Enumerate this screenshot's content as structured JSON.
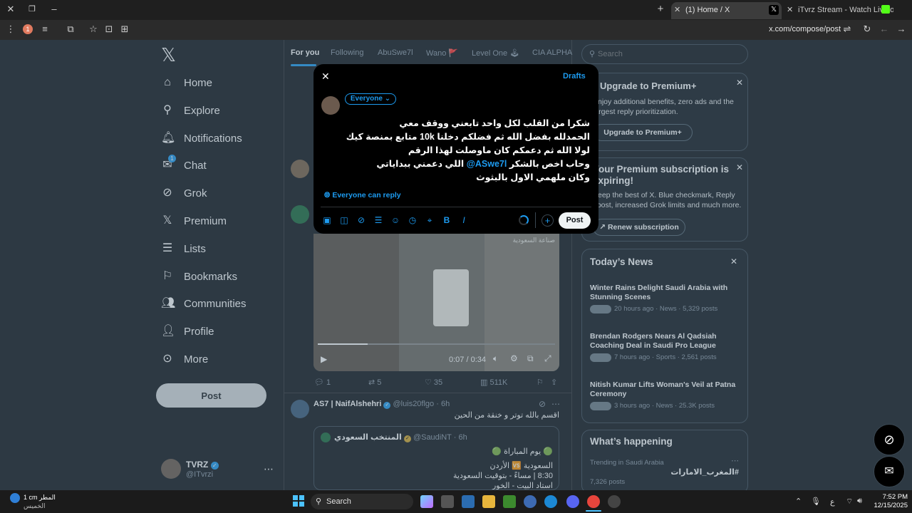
{
  "browser": {
    "tabs": [
      {
        "title": "(1) Home / X",
        "active": true
      },
      {
        "title": "iTvrz Stream - Watch Live on Ki",
        "active": false
      }
    ],
    "url": "x.com/compose/post",
    "profile_badge": "1"
  },
  "feed_tabs": [
    "For you",
    "Following",
    "AbuSwe7l",
    "Wano 🚩",
    "Level One 🕹",
    "CIA ALPHA"
  ],
  "search": {
    "placeholder": "Search"
  },
  "sidebar": {
    "items": [
      {
        "label": "Home",
        "icon": "home-icon"
      },
      {
        "label": "Explore",
        "icon": "search-icon"
      },
      {
        "label": "Notifications",
        "icon": "bell-icon"
      },
      {
        "label": "Chat",
        "icon": "mail-icon",
        "badge": "1"
      },
      {
        "label": "Grok",
        "icon": "grok-icon"
      },
      {
        "label": "Premium",
        "icon": "x-icon"
      },
      {
        "label": "Lists",
        "icon": "list-icon"
      },
      {
        "label": "Bookmarks",
        "icon": "bookmark-icon"
      },
      {
        "label": "Communities",
        "icon": "people-icon"
      },
      {
        "label": "Profile",
        "icon": "person-icon"
      },
      {
        "label": "More",
        "icon": "more-icon"
      }
    ],
    "post_button": "Post",
    "account": {
      "name": "TVRZ",
      "handle": "@ITvrzi"
    }
  },
  "compose": {
    "drafts": "Drafts",
    "audience": "Everyone",
    "text_lines": [
      "شكرا من القلب لكل واحد تابعني ووقف معي",
      "الحمدلله بفضل الله ثم فضلكم دخلنا 10k متابع بمنصة كيك",
      "لولا الله ثم دعمكم كان ماوصلت لهذا الرقم",
      "وحاب اخص بالشكر",
      "وكان ملهمي الاول بالبثوث"
    ],
    "mention": "@ASwe7l",
    "mention_suffix": "اللي دعمني ببداياتي",
    "reply_setting": "Everyone can reply",
    "post_button": "Post"
  },
  "video": {
    "time": "0:07 / 0:34",
    "watermark": "صناعة السعودية"
  },
  "post_actions": {
    "replies": "1",
    "reposts": "5",
    "likes": "35",
    "views": "511K"
  },
  "tweet": {
    "name": "AS7 | NaifAlshehri",
    "handle": "@luis20flgo",
    "time": "6h",
    "text": "اقسم بالله توتر و خنقة من الحين",
    "quote": {
      "name": "المنتخب السعودي",
      "handle": "@SaudiNT",
      "time": "6h",
      "lines": [
        "🟢 يوم المباراة 🟢",
        "السعودية 🆚 الأردن",
        "8:30 | مساءً - بتوقيت السعودية",
        "استاد البيت - الخور"
      ]
    }
  },
  "right": {
    "premium_plus": {
      "title": "Upgrade to Premium+",
      "body": "Enjoy additional benefits, zero ads and the largest reply prioritization.",
      "button": "Upgrade to Premium+"
    },
    "expiring": {
      "title": "Your Premium subscription is expiring!",
      "body": "Keep the best of X. Blue checkmark, Reply boost, increased Grok limits and much more.",
      "button": "Renew subscription"
    },
    "news": {
      "title": "Today’s News",
      "items": [
        {
          "headline": "Winter Rains Delight Saudi Arabia with Stunning Scenes",
          "meta": "20 hours ago · News · 5,329 posts"
        },
        {
          "headline": "Brendan Rodgers Nears Al Qadsiah Coaching Deal in Saudi Pro League",
          "meta": "7 hours ago · Sports · 2,561 posts"
        },
        {
          "headline": "Nitish Kumar Lifts Woman's Veil at Patna Ceremony",
          "meta": "3 hours ago · News · 25.3K posts"
        }
      ]
    },
    "happening": {
      "title": "What’s happening",
      "trend_context": "Trending in Saudi Arabia",
      "trend": "#المغرب_الامارات",
      "trend_count": "7,326 posts"
    }
  },
  "taskbar": {
    "weather_temp": "1 cm",
    "weather_label": "المطر",
    "weather_sub": "الخميس",
    "search": "Search",
    "lang": "ع",
    "time": "7:52 PM",
    "date": "12/15/2025"
  },
  "colors": {
    "accent": "#1d9bf0",
    "bg": "#0f1419",
    "modal": "#000000"
  }
}
